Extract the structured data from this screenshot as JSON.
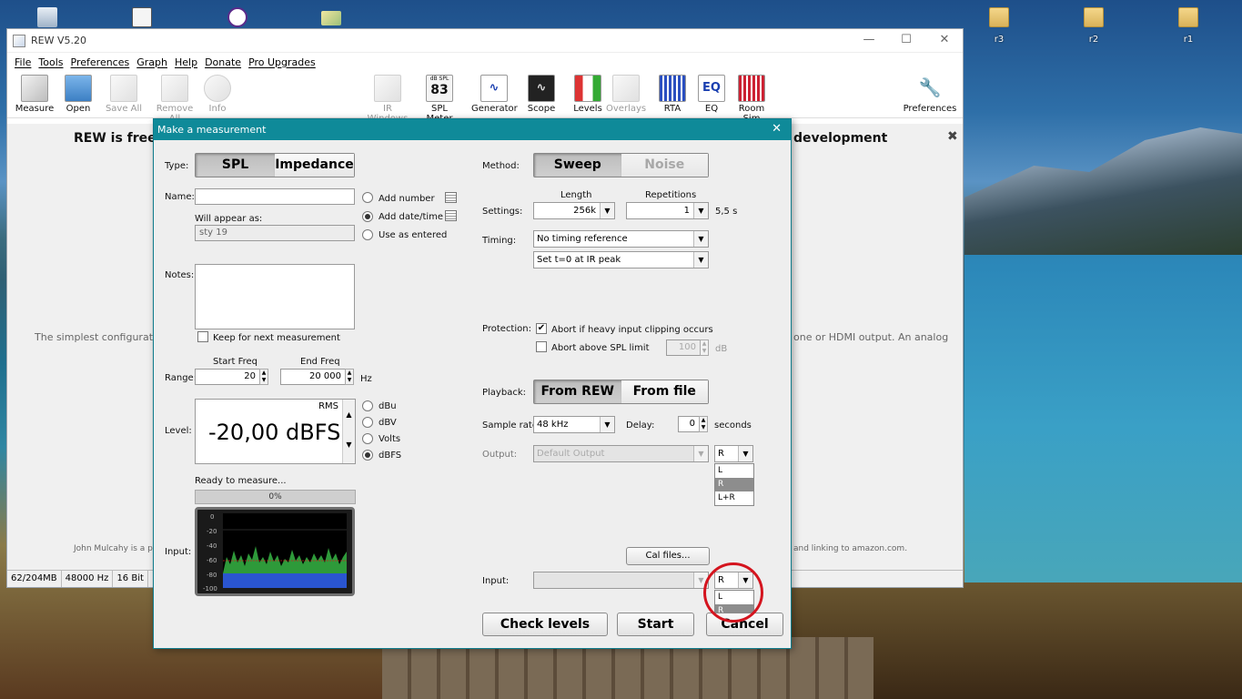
{
  "desktop": {
    "icons": [
      {
        "name": "recycle-bin",
        "label": ""
      },
      {
        "name": "app-1",
        "label": ""
      },
      {
        "name": "app-2",
        "label": ""
      },
      {
        "name": "app-3",
        "label": ""
      },
      {
        "name": "folder-r3",
        "label": "r3"
      },
      {
        "name": "folder-r2",
        "label": "r2"
      },
      {
        "name": "folder-r1",
        "label": "r1"
      }
    ]
  },
  "main": {
    "title": "REW V5.20",
    "menu": [
      "File",
      "Tools",
      "Preferences",
      "Graph",
      "Help",
      "Donate",
      "Pro Upgrades"
    ],
    "toolbar": [
      {
        "label": "Measure",
        "icon": "measure-icon",
        "enabled": true
      },
      {
        "label": "Open",
        "icon": "folder-icon",
        "enabled": true
      },
      {
        "label": "Save All",
        "icon": "save-icon",
        "enabled": false
      },
      {
        "label": "Remove All",
        "icon": "remove-icon",
        "enabled": false
      },
      {
        "label": "Info",
        "icon": "info-icon",
        "enabled": false
      },
      {
        "label": "IR Windows",
        "icon": "ir-windows-icon",
        "enabled": false
      },
      {
        "label": "SPL Meter",
        "icon": "spl-meter-icon",
        "enabled": true,
        "glyph": "83"
      },
      {
        "label": "Generator",
        "icon": "generator-icon",
        "enabled": true
      },
      {
        "label": "Scope",
        "icon": "scope-icon",
        "enabled": true
      },
      {
        "label": "Levels",
        "icon": "levels-icon",
        "enabled": true
      },
      {
        "label": "Overlays",
        "icon": "overlays-icon",
        "enabled": false
      },
      {
        "label": "RTA",
        "icon": "rta-icon",
        "enabled": true
      },
      {
        "label": "EQ",
        "icon": "eq-icon",
        "enabled": true,
        "glyph": "EQ"
      },
      {
        "label": "Room Sim",
        "icon": "room-sim-icon",
        "enabled": true
      },
      {
        "label": "Preferences",
        "icon": "wrench-icon",
        "enabled": true
      }
    ],
    "spl_glyph_top": "dB SPL",
    "banner_left": "REW is free",
    "banner_right": "development",
    "body_left": "The simplest configuration",
    "body_right": "one or HDMI output. An analog",
    "footer_left": "John Mulcahy is a pa",
    "footer_right": "and linking to amazon.com.",
    "status": [
      "62/204MB",
      "48000 Hz",
      "16 Bit"
    ]
  },
  "dialog": {
    "title": "Make a measurement",
    "type_label": "Type:",
    "type_options": [
      "SPL",
      "Impedance"
    ],
    "name_label": "Name:",
    "name_value": "",
    "will_appear_label": "Will appear as:",
    "will_appear_value": "sty 19",
    "name_options": [
      "Add number",
      "Add date/time",
      "Use as entered"
    ],
    "notes_label": "Notes:",
    "keep_label": "Keep for next measurement",
    "start_freq_label": "Start Freq",
    "end_freq_label": "End Freq",
    "range_label": "Range:",
    "start_freq": "20",
    "end_freq": "20 000",
    "hz": "Hz",
    "level_label": "Level:",
    "rms": "RMS",
    "level_value": "-20,00 dBFS",
    "level_units": [
      "dBu",
      "dBV",
      "Volts",
      "dBFS"
    ],
    "ready": "Ready to measure...",
    "progress": "0%",
    "input_label": "Input:",
    "scope_ticks": [
      "0",
      "-20",
      "-40",
      "-60",
      "-80",
      "-100"
    ],
    "method_label": "Method:",
    "method_options": [
      "Sweep",
      "Noise"
    ],
    "length_label": "Length",
    "repetitions_label": "Repetitions",
    "settings_label": "Settings:",
    "length_value": "256k",
    "repetitions_value": "1",
    "duration": "5,5 s",
    "timing_label": "Timing:",
    "timing_ref": "No timing reference",
    "timing_t0": "Set t=0 at IR peak",
    "protection_label": "Protection:",
    "abort_clip": "Abort if heavy input clipping occurs",
    "abort_spl": "Abort above SPL limit",
    "spl_limit": "100",
    "db": "dB",
    "playback_label": "Playback:",
    "playback_options": [
      "From REW",
      "From file"
    ],
    "sample_rate_label": "Sample rate:",
    "sample_rate": "48 kHz",
    "delay_label": "Delay:",
    "delay": "0",
    "seconds": "seconds",
    "output_label": "Output:",
    "output_device": "Default Output",
    "output_channel": "R",
    "output_channel_options": [
      "L",
      "R",
      "L+R"
    ],
    "cal_files": "Cal files...",
    "input_row_label": "Input:",
    "input_device": "",
    "input_channel": "R",
    "input_channel_options": [
      "L",
      "R"
    ],
    "buttons": {
      "check": "Check levels",
      "start": "Start",
      "cancel": "Cancel"
    }
  },
  "colors": {
    "dialog_title": "#0f8a99",
    "highlight": "#d4141e"
  }
}
